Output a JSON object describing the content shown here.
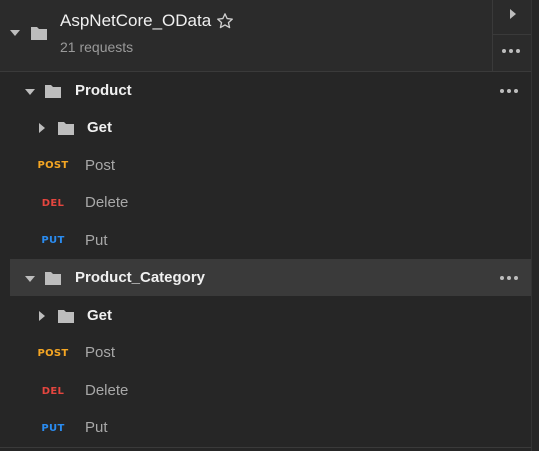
{
  "collection": {
    "name": "AspNetCore_OData",
    "request_count": "21 requests"
  },
  "colors": {
    "post": "#f5a623",
    "del": "#e5463f",
    "put": "#2a8cf0"
  },
  "folders": [
    {
      "label": "Product",
      "subfolder": "Get",
      "requests": [
        {
          "method": "POST",
          "label": "Post"
        },
        {
          "method": "DEL",
          "label": "Delete"
        },
        {
          "method": "PUT",
          "label": "Put"
        }
      ]
    },
    {
      "label": "Product_Category",
      "subfolder": "Get",
      "requests": [
        {
          "method": "POST",
          "label": "Post"
        },
        {
          "method": "DEL",
          "label": "Delete"
        },
        {
          "method": "PUT",
          "label": "Put"
        }
      ]
    }
  ]
}
